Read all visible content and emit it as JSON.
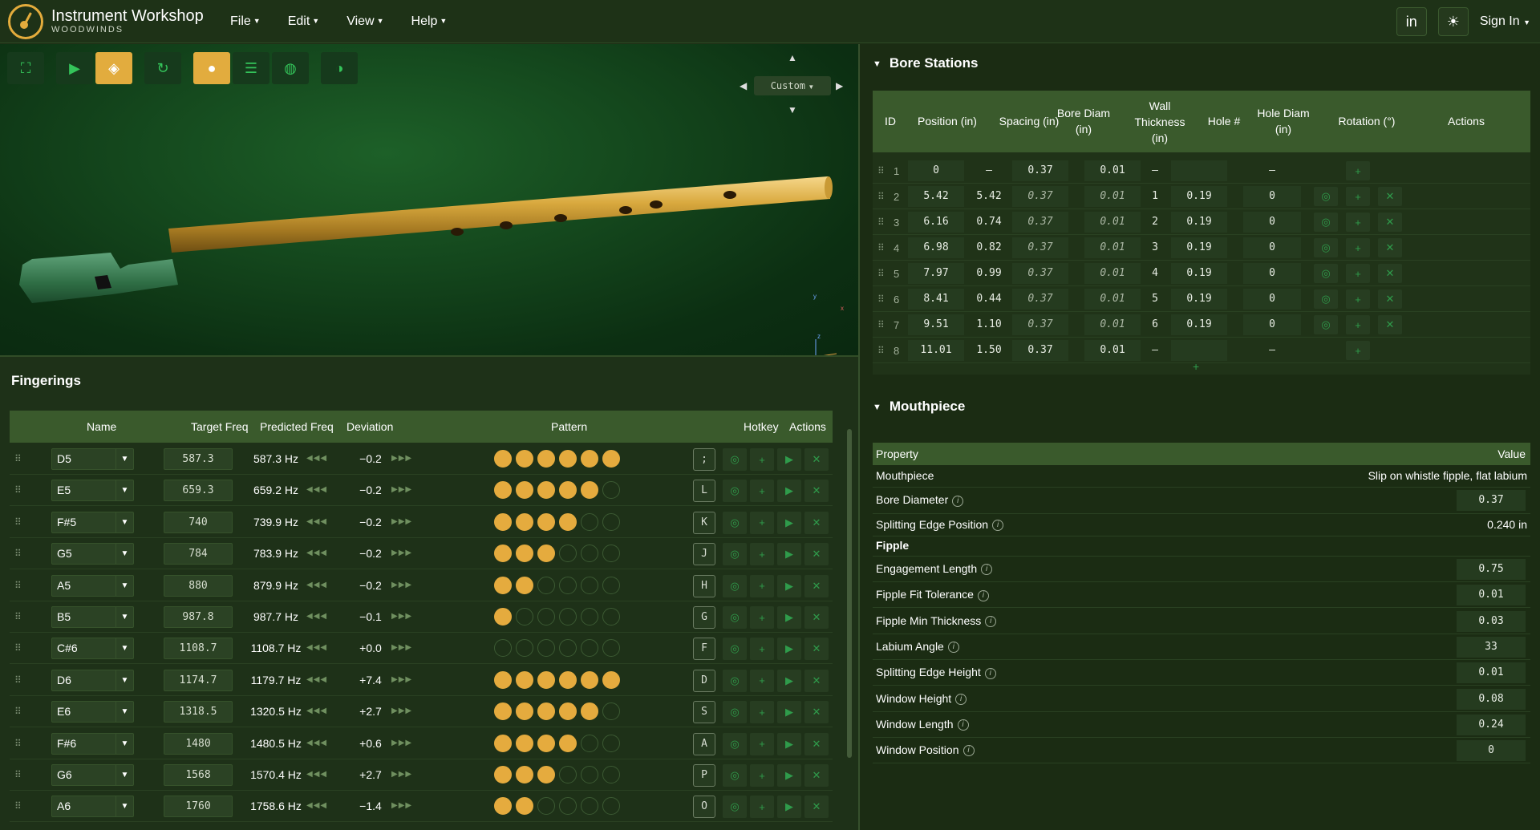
{
  "app": {
    "title": "Instrument Workshop",
    "subtitle": "WOODWINDS"
  },
  "menus": [
    "File",
    "Edit",
    "View",
    "Help"
  ],
  "topright": {
    "linkedin": "in",
    "theme_icon": "sun-icon",
    "signin": "Sign In"
  },
  "viewer": {
    "toolbar_icons": [
      "fullscreen-icon",
      "play-icon",
      "cube-icon",
      "reset-icon",
      "sphere-icon",
      "stripes-icon",
      "rings-icon",
      "half-icon"
    ],
    "active": [
      "cube-icon",
      "sphere-icon"
    ],
    "view_preset": "Custom",
    "axes": {
      "x": "x",
      "y": "y",
      "z": "z"
    }
  },
  "fingerings": {
    "title": "Fingerings",
    "columns": [
      "Name",
      "Target Freq",
      "Predicted Freq",
      "Deviation",
      "Pattern",
      "Hotkey",
      "Actions"
    ],
    "rows": [
      {
        "name": "D5",
        "target": "587.3",
        "predicted": "587.3 Hz",
        "deviation": "−0.2",
        "holes": [
          1,
          1,
          1,
          1,
          1,
          1
        ],
        "hotkey": ";"
      },
      {
        "name": "E5",
        "target": "659.3",
        "predicted": "659.2 Hz",
        "deviation": "−0.2",
        "holes": [
          1,
          1,
          1,
          1,
          1,
          0
        ],
        "hotkey": "L"
      },
      {
        "name": "F#5",
        "target": "740",
        "predicted": "739.9 Hz",
        "deviation": "−0.2",
        "holes": [
          1,
          1,
          1,
          1,
          0,
          0
        ],
        "hotkey": "K"
      },
      {
        "name": "G5",
        "target": "784",
        "predicted": "783.9 Hz",
        "deviation": "−0.2",
        "holes": [
          1,
          1,
          1,
          0,
          0,
          0
        ],
        "hotkey": "J"
      },
      {
        "name": "A5",
        "target": "880",
        "predicted": "879.9 Hz",
        "deviation": "−0.2",
        "holes": [
          1,
          1,
          0,
          0,
          0,
          0
        ],
        "hotkey": "H"
      },
      {
        "name": "B5",
        "target": "987.8",
        "predicted": "987.7 Hz",
        "deviation": "−0.1",
        "holes": [
          1,
          0,
          0,
          0,
          0,
          0
        ],
        "hotkey": "G"
      },
      {
        "name": "C#6",
        "target": "1108.7",
        "predicted": "1108.7 Hz",
        "deviation": "+0.0",
        "holes": [
          0,
          0,
          0,
          0,
          0,
          0
        ],
        "hotkey": "F"
      },
      {
        "name": "D6",
        "target": "1174.7",
        "predicted": "1179.7 Hz",
        "deviation": "+7.4",
        "holes": [
          1,
          1,
          1,
          1,
          1,
          1
        ],
        "hotkey": "D"
      },
      {
        "name": "E6",
        "target": "1318.5",
        "predicted": "1320.5 Hz",
        "deviation": "+2.7",
        "holes": [
          1,
          1,
          1,
          1,
          1,
          0
        ],
        "hotkey": "S"
      },
      {
        "name": "F#6",
        "target": "1480",
        "predicted": "1480.5 Hz",
        "deviation": "+0.6",
        "holes": [
          1,
          1,
          1,
          1,
          0,
          0
        ],
        "hotkey": "A"
      },
      {
        "name": "G6",
        "target": "1568",
        "predicted": "1570.4 Hz",
        "deviation": "+2.7",
        "holes": [
          1,
          1,
          1,
          0,
          0,
          0
        ],
        "hotkey": "P"
      },
      {
        "name": "A6",
        "target": "1760",
        "predicted": "1758.6 Hz",
        "deviation": "−1.4",
        "holes": [
          1,
          1,
          0,
          0,
          0,
          0
        ],
        "hotkey": "O"
      }
    ]
  },
  "bore": {
    "title": "Bore Stations",
    "columns": {
      "id": "ID",
      "position": "Position (in)",
      "spacing": "Spacing (in)",
      "bore_diam": "Bore Diam (in)",
      "wall": "Wall Thickness (in)",
      "hole": "Hole #",
      "hole_diam": "Hole Diam (in)",
      "rotation": "Rotation (°)",
      "actions": "Actions"
    },
    "rows": [
      {
        "id": "1",
        "position": "0",
        "spacing": "—",
        "bore_diam": "0.37",
        "wall": "0.01",
        "hole": "—",
        "hole_diam": "",
        "rotation": "—",
        "end": true
      },
      {
        "id": "2",
        "position": "5.42",
        "spacing": "5.42",
        "bore_diam": "0.37",
        "wall": "0.01",
        "hole": "1",
        "hole_diam": "0.19",
        "rotation": "0",
        "end": false
      },
      {
        "id": "3",
        "position": "6.16",
        "spacing": "0.74",
        "bore_diam": "0.37",
        "wall": "0.01",
        "hole": "2",
        "hole_diam": "0.19",
        "rotation": "0",
        "end": false
      },
      {
        "id": "4",
        "position": "6.98",
        "spacing": "0.82",
        "bore_diam": "0.37",
        "wall": "0.01",
        "hole": "3",
        "hole_diam": "0.19",
        "rotation": "0",
        "end": false
      },
      {
        "id": "5",
        "position": "7.97",
        "spacing": "0.99",
        "bore_diam": "0.37",
        "wall": "0.01",
        "hole": "4",
        "hole_diam": "0.19",
        "rotation": "0",
        "end": false
      },
      {
        "id": "6",
        "position": "8.41",
        "spacing": "0.44",
        "bore_diam": "0.37",
        "wall": "0.01",
        "hole": "5",
        "hole_diam": "0.19",
        "rotation": "0",
        "end": false
      },
      {
        "id": "7",
        "position": "9.51",
        "spacing": "1.10",
        "bore_diam": "0.37",
        "wall": "0.01",
        "hole": "6",
        "hole_diam": "0.19",
        "rotation": "0",
        "end": false
      },
      {
        "id": "8",
        "position": "11.01",
        "spacing": "1.50",
        "bore_diam": "0.37",
        "wall": "0.01",
        "hole": "—",
        "hole_diam": "",
        "rotation": "—",
        "end": true
      }
    ]
  },
  "mouthpiece": {
    "title": "Mouthpiece",
    "columns": {
      "property": "Property",
      "value": "Value"
    },
    "rows": [
      {
        "label": "Mouthpiece",
        "value": "Slip on whistle fipple, flat labium",
        "kind": "text",
        "info": false
      },
      {
        "label": "Bore Diameter",
        "value": "0.37",
        "kind": "box",
        "info": true
      },
      {
        "label": "Splitting Edge Position",
        "value": "0.240 in",
        "kind": "text",
        "info": true
      },
      {
        "label": "Fipple",
        "value": "",
        "kind": "section",
        "info": false
      },
      {
        "label": "Engagement Length",
        "value": "0.75",
        "kind": "box",
        "info": true
      },
      {
        "label": "Fipple Fit Tolerance",
        "value": "0.01",
        "kind": "box",
        "info": true
      },
      {
        "label": "Fipple Min Thickness",
        "value": "0.03",
        "kind": "box",
        "info": true
      },
      {
        "label": "Labium Angle",
        "value": "33",
        "kind": "box",
        "info": true
      },
      {
        "label": "Splitting Edge Height",
        "value": "0.01",
        "kind": "box",
        "info": true
      },
      {
        "label": "Window Height",
        "value": "0.08",
        "kind": "box",
        "info": true
      },
      {
        "label": "Window Length",
        "value": "0.24",
        "kind": "box",
        "info": true
      },
      {
        "label": "Window Position",
        "value": "0",
        "kind": "box",
        "info": true
      }
    ]
  },
  "colors": {
    "accent": "#e5ab3e",
    "header": "#3a5a2c",
    "bg": "#1b2c13",
    "action": "#2f9b4b"
  }
}
